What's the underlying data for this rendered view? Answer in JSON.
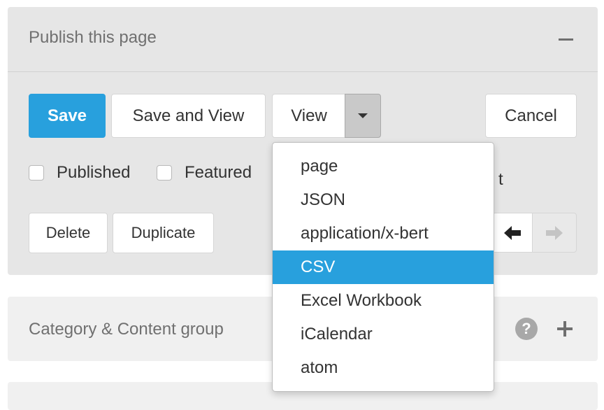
{
  "publish_panel": {
    "title": "Publish this page",
    "buttons": {
      "save": "Save",
      "save_and_view": "Save and View",
      "view": "View",
      "cancel": "Cancel",
      "delete": "Delete",
      "duplicate": "Duplicate"
    },
    "checkboxes": [
      {
        "label": "Published",
        "checked": false
      },
      {
        "label": "Featured",
        "checked": false
      }
    ],
    "hidden_option_tail": "t"
  },
  "view_menu": {
    "items": [
      "page",
      "JSON",
      "application/x-bert",
      "CSV",
      "Excel Workbook",
      "iCalendar",
      "atom"
    ],
    "selected": "CSV"
  },
  "category_panel": {
    "title": "Category & Content group",
    "help_icon_glyph": "?"
  },
  "colors": {
    "primary": "#28a0dd",
    "panel_bg": "#e6e6e6",
    "card_bg": "#f0f0f0"
  },
  "icons": [
    "minus-icon",
    "caret-down-icon",
    "arrow-left-icon",
    "arrow-right-icon",
    "question-circle-icon",
    "plus-icon"
  ]
}
